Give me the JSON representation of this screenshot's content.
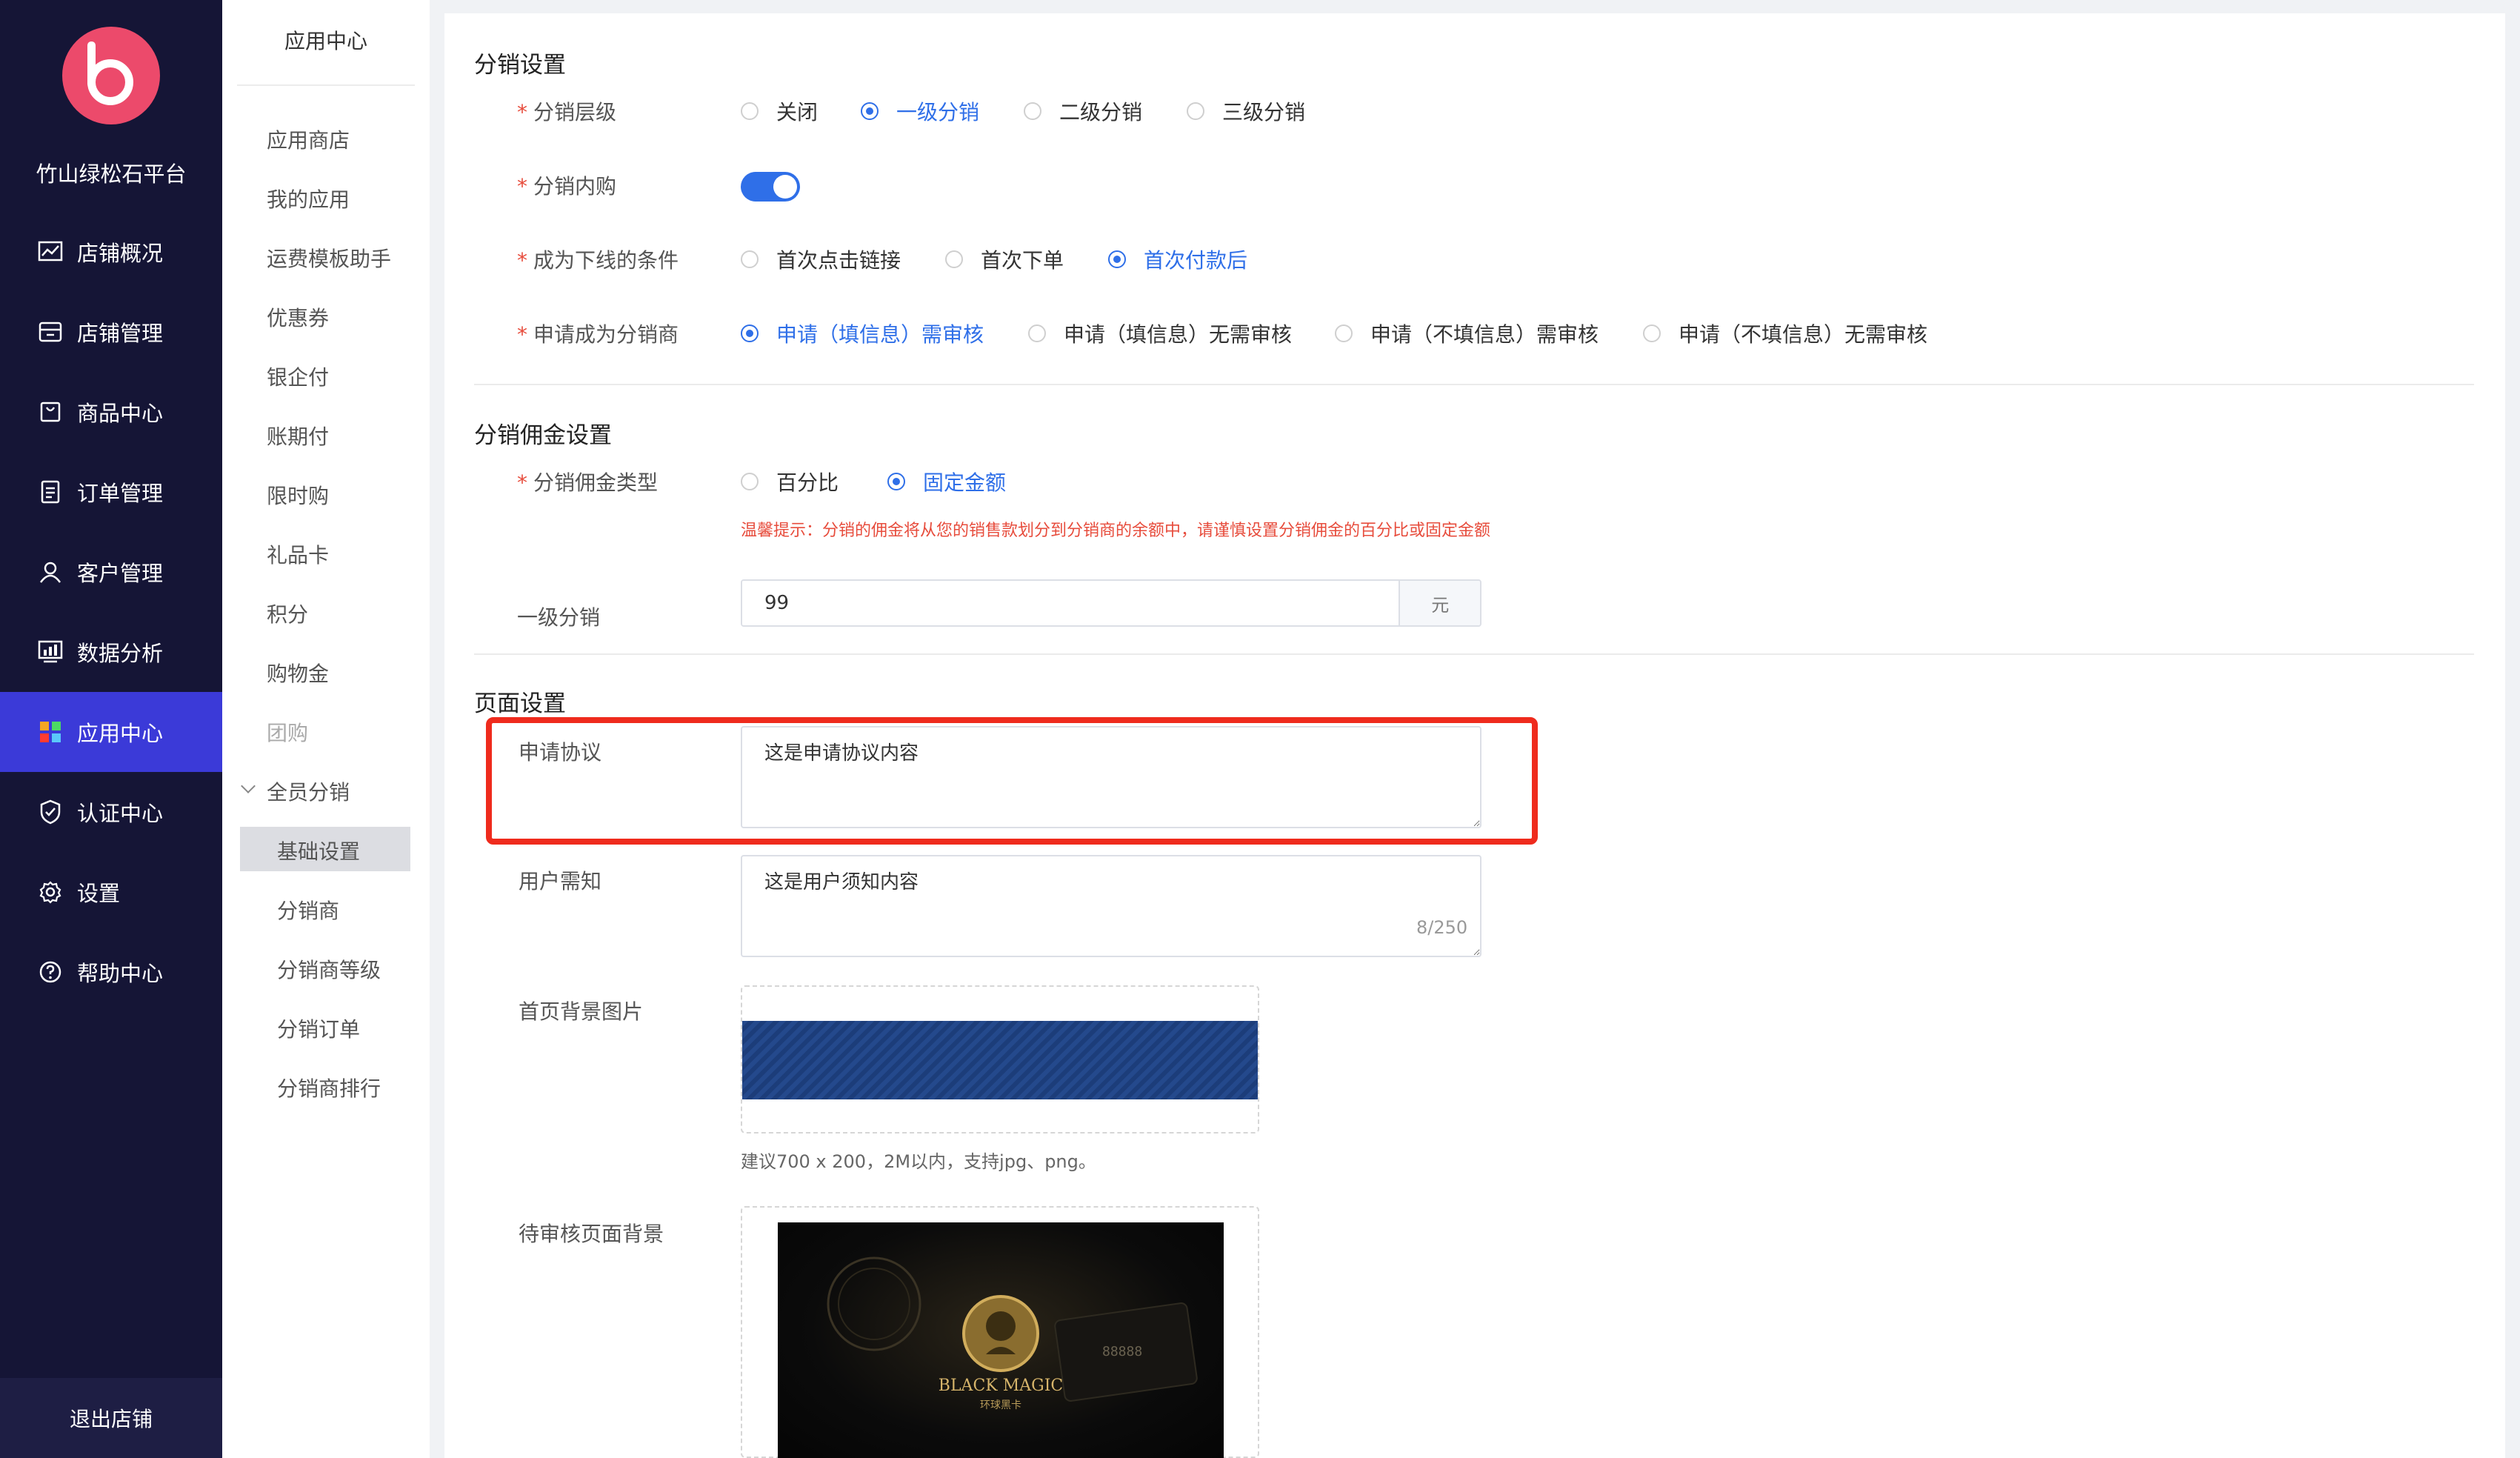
{
  "nav": {
    "platform": "竹山绿松石平台",
    "items": [
      {
        "label": "店铺概况",
        "icon": "chart-line-icon"
      },
      {
        "label": "店铺管理",
        "icon": "store-icon"
      },
      {
        "label": "商品中心",
        "icon": "shopping-bag-icon"
      },
      {
        "label": "订单管理",
        "icon": "document-icon"
      },
      {
        "label": "客户管理",
        "icon": "user-icon"
      },
      {
        "label": "数据分析",
        "icon": "bar-chart-icon"
      },
      {
        "label": "应用中心",
        "icon": "apps-grid-icon",
        "active": true
      },
      {
        "label": "认证中心",
        "icon": "shield-icon"
      },
      {
        "label": "设置",
        "icon": "gear-icon"
      },
      {
        "label": "帮助中心",
        "icon": "help-circle-icon"
      }
    ],
    "logout": "退出店铺"
  },
  "submenu": {
    "title": "应用中心",
    "items": [
      "应用商店",
      "我的应用",
      "运费模板助手",
      "优惠券",
      "银企付",
      "账期付",
      "限时购",
      "礼品卡",
      "积分",
      "购物金",
      "团购"
    ],
    "group": "全员分销",
    "children": [
      "基础设置",
      "分销商",
      "分销商等级",
      "分销订单",
      "分销商排行"
    ]
  },
  "distribution": {
    "title": "分销设置",
    "level": {
      "label": "分销层级",
      "options": [
        "关闭",
        "一级分销",
        "二级分销",
        "三级分销"
      ],
      "selected": 1
    },
    "internal": {
      "label": "分销内购",
      "on": true
    },
    "downline": {
      "label": "成为下线的条件",
      "options": [
        "首次点击链接",
        "首次下单",
        "首次付款后"
      ],
      "selected": 2
    },
    "apply": {
      "label": "申请成为分销商",
      "options": [
        "申请（填信息）需审核",
        "申请（填信息）无需审核",
        "申请（不填信息）需审核",
        "申请（不填信息）无需审核"
      ],
      "selected": 0
    }
  },
  "commission": {
    "title": "分销佣金设置",
    "type": {
      "label": "分销佣金类型",
      "options": [
        "百分比",
        "固定金额"
      ],
      "selected": 1
    },
    "tip": "温馨提示：分销的佣金将从您的销售款划分到分销商的余额中，请谨慎设置分销佣金的百分比或固定金额",
    "level1": {
      "label": "一级分销",
      "value": "99",
      "suffix": "元"
    }
  },
  "page": {
    "title": "页面设置",
    "agreement": {
      "label": "申请协议",
      "value": "这是申请协议内容"
    },
    "notice": {
      "label": "用户需知",
      "value": "这是用户须知内容",
      "count": "8/250"
    },
    "home_bg": {
      "label": "首页背景图片",
      "hint": "建议700 x 200，2M以内，支持jpg、png。"
    },
    "pending_bg": {
      "label": "待审核页面背景",
      "brand": "BLACK MAGIC",
      "sub": "环球黑卡",
      "card_number": "88888"
    }
  },
  "colors": {
    "accent": "#2f6fe8",
    "nav_bg": "#151536",
    "nav_active": "#3b3ad8",
    "highlight": "#ef2b1d",
    "logo": "#ec4a6b"
  }
}
